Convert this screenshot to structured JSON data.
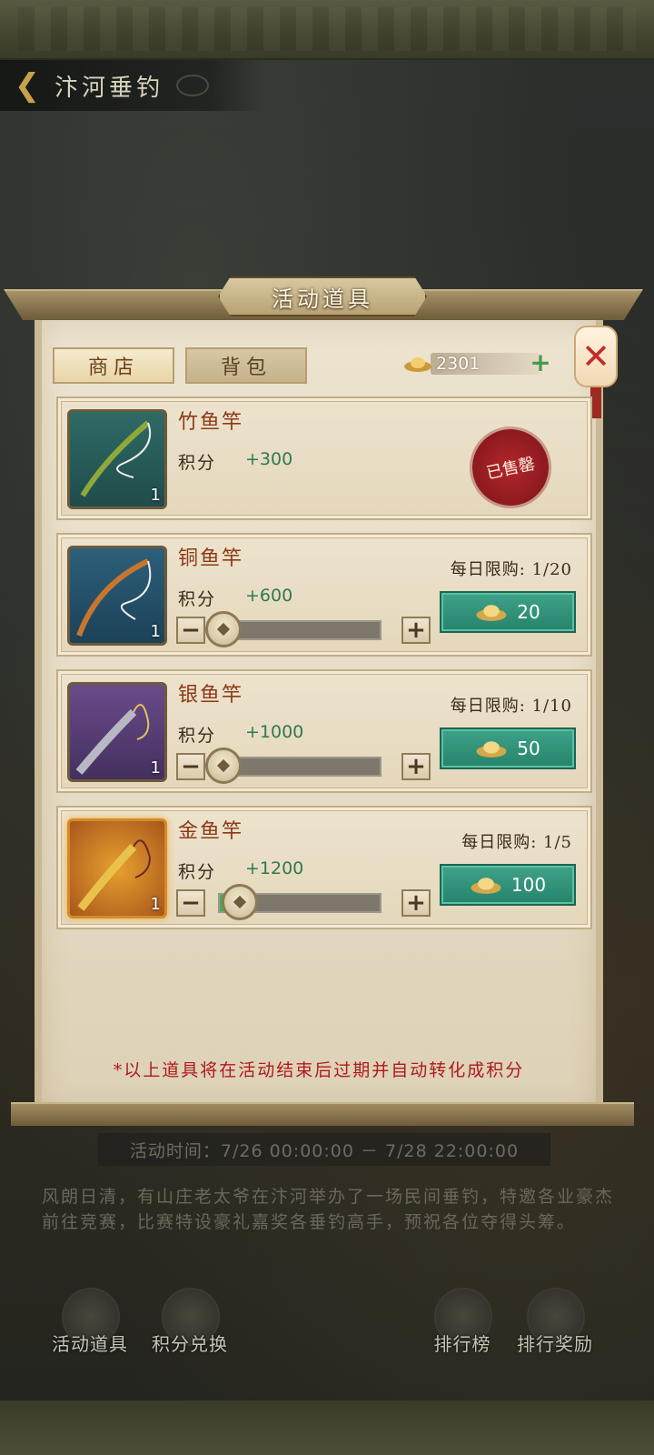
{
  "header": {
    "title": "汴河垂钓"
  },
  "modal": {
    "title": "活动道具",
    "tabs": [
      {
        "label": "商店"
      },
      {
        "label": "背包"
      }
    ],
    "currency": {
      "value": "2301"
    },
    "points_label": "积分",
    "items": [
      {
        "name": "竹鱼竿",
        "points": "+300",
        "count": "1",
        "status": "已售罄"
      },
      {
        "name": "铜鱼竿",
        "points": "+600",
        "count": "1",
        "limit": "每日限购: 1/20",
        "price": "20",
        "slider_fraction": 0
      },
      {
        "name": "银鱼竿",
        "points": "+1000",
        "count": "1",
        "limit": "每日限购: 1/10",
        "price": "50",
        "slider_fraction": 0
      },
      {
        "name": "金鱼竿",
        "points": "+1200",
        "count": "1",
        "limit": "每日限购: 1/5",
        "price": "100",
        "slider_fraction": 0.1
      }
    ],
    "notice": "*以上道具将在活动结束后过期并自动转化成积分"
  },
  "event": {
    "time": "活动时间：7/26 00:00:00 － 7/28 22:00:00",
    "description": "风朗日清，有山庄老太爷在汴河举办了一场民间垂钓，特邀各业豪杰前往竞赛，比赛特设豪礼嘉奖各垂钓高手，预祝各位夺得头筹。"
  },
  "nav": [
    {
      "label": "活动道具"
    },
    {
      "label": "积分兑换"
    },
    {
      "label": "排行榜"
    },
    {
      "label": "排行奖励"
    }
  ],
  "colors": {
    "accent_green": "#2e7a4a",
    "buy_button": "#26836b",
    "sold_stamp": "#b2262a",
    "notice_red": "#b01a1a"
  }
}
